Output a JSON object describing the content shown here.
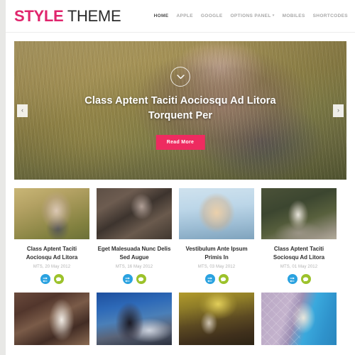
{
  "header": {
    "logo_style": "STYLE",
    "logo_theme": " THEME",
    "nav_items": [
      {
        "label": "HOME",
        "active": true,
        "has_caret": false
      },
      {
        "label": "APPLE",
        "active": false,
        "has_caret": false
      },
      {
        "label": "GOOGLE",
        "active": false,
        "has_caret": false
      },
      {
        "label": "OPTIONS PANEL",
        "active": false,
        "has_caret": true
      },
      {
        "label": "MOBILES",
        "active": false,
        "has_caret": false
      },
      {
        "label": "SHORTCODES",
        "active": false,
        "has_caret": false
      }
    ]
  },
  "hero": {
    "title": "Class Aptent Taciti Aociosqu Ad Litora Torquent Per",
    "read_more_label": "Read More",
    "prev_arrow": "‹",
    "next_arrow": "›",
    "accent_color": "#ee2b60"
  },
  "posts": [
    {
      "title": "Class Aptent Taciti Aociosqu Ad Litora",
      "date": "MTS, 20 May 2012",
      "thumb_class": "ph-p1"
    },
    {
      "title": "Eget Malesuada Nunc Delis Sed Augue",
      "date": "MTS, 16 May 2012",
      "thumb_class": "ph-p2"
    },
    {
      "title": "Vestibulum Ante Ipsum Primis In",
      "date": "MTS, 03 May 2012",
      "thumb_class": "ph-p3"
    },
    {
      "title": "Class Aptent Taciti Sociosqu Ad Litora",
      "date": "MTS, 01 May 2012",
      "thumb_class": "ph-p4"
    }
  ],
  "post_icons": {
    "share_color": "#2aa2e0",
    "comment_color": "#9cc22b"
  },
  "gallery": [
    {
      "thumb_class": "ph-g1"
    },
    {
      "thumb_class": "ph-g2"
    },
    {
      "thumb_class": "ph-g3"
    },
    {
      "thumb_class": "ph-g4"
    }
  ],
  "colors": {
    "brand_pink": "#e0256d",
    "page_bg": "#e8e8e6",
    "content_bg": "#ffffff"
  }
}
